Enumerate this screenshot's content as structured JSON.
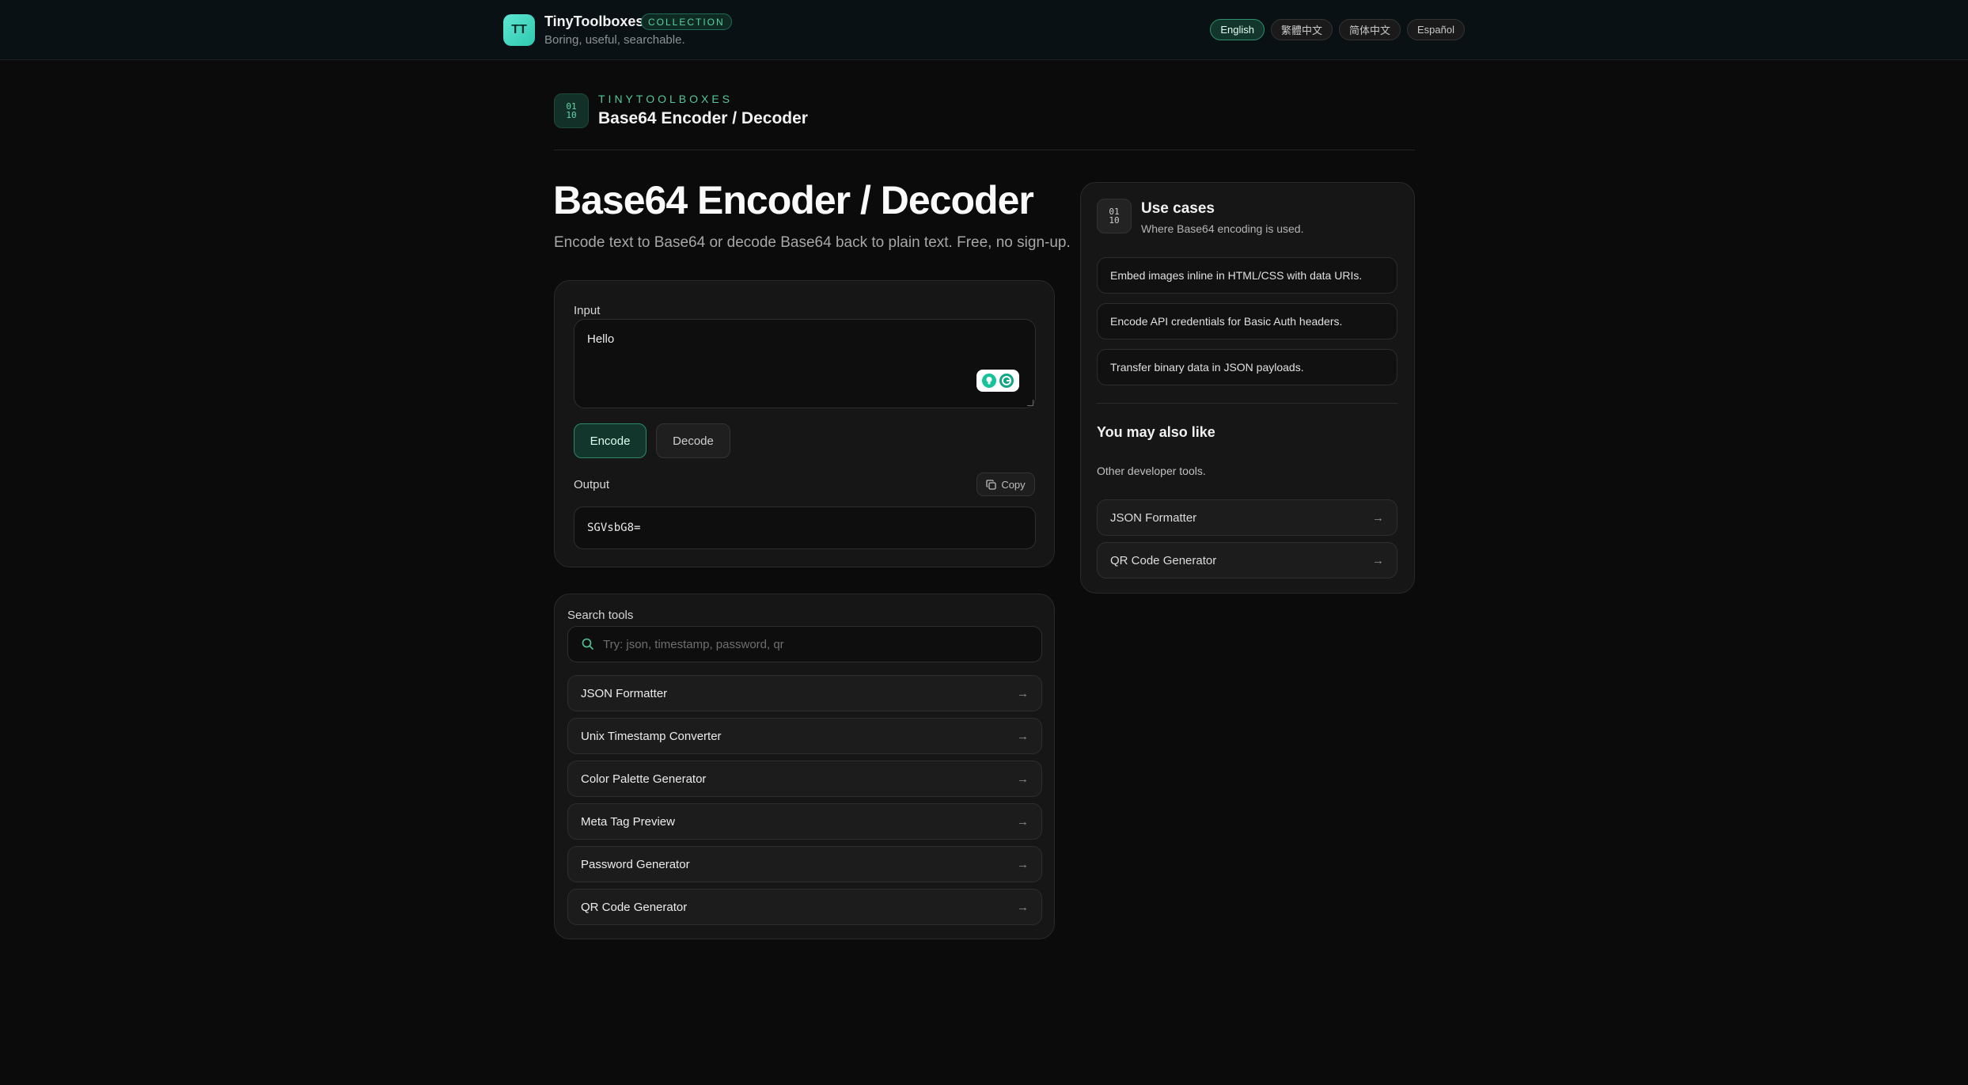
{
  "header": {
    "logo_text": "TT",
    "brand_name": "TinyToolboxes",
    "badge": "COLLECTION",
    "tagline": "Boring, useful, searchable.",
    "languages": [
      {
        "label": "English",
        "active": true
      },
      {
        "label": "繁體中文",
        "active": false
      },
      {
        "label": "简体中文",
        "active": false
      },
      {
        "label": "Español",
        "active": false
      }
    ]
  },
  "breadcrumb": {
    "icon_text_top": "01",
    "icon_text_bottom": "10",
    "kicker": "TINYTOOLBOXES",
    "title": "Base64 Encoder / Decoder"
  },
  "hero": {
    "title": "Base64 Encoder / Decoder",
    "subtitle": "Encode text to Base64 or decode Base64 back to plain text. Free, no sign-up."
  },
  "tool": {
    "input_label": "Input",
    "input_value": "Hello",
    "encode_label": "Encode",
    "decode_label": "Decode",
    "output_label": "Output",
    "copy_label": "Copy",
    "output_value": "SGVsbG8="
  },
  "search": {
    "label": "Search tools",
    "placeholder": "Try: json, timestamp, password, qr",
    "items": [
      "JSON Formatter",
      "Unix Timestamp Converter",
      "Color Palette Generator",
      "Meta Tag Preview",
      "Password Generator",
      "QR Code Generator"
    ]
  },
  "sidebar": {
    "title": "Use cases",
    "subtitle": "Where Base64 encoding is used.",
    "use_cases": [
      "Embed images inline in HTML/CSS with data URIs.",
      "Encode API credentials for Basic Auth headers.",
      "Transfer binary data in JSON payloads."
    ],
    "also_title": "You may also like",
    "also_subtitle": "Other developer tools.",
    "also_items": [
      "JSON Formatter",
      "QR Code Generator"
    ]
  },
  "colors": {
    "background": "#0b0b0b",
    "accent": "#55c79a",
    "brand": "#2fc8b0"
  }
}
